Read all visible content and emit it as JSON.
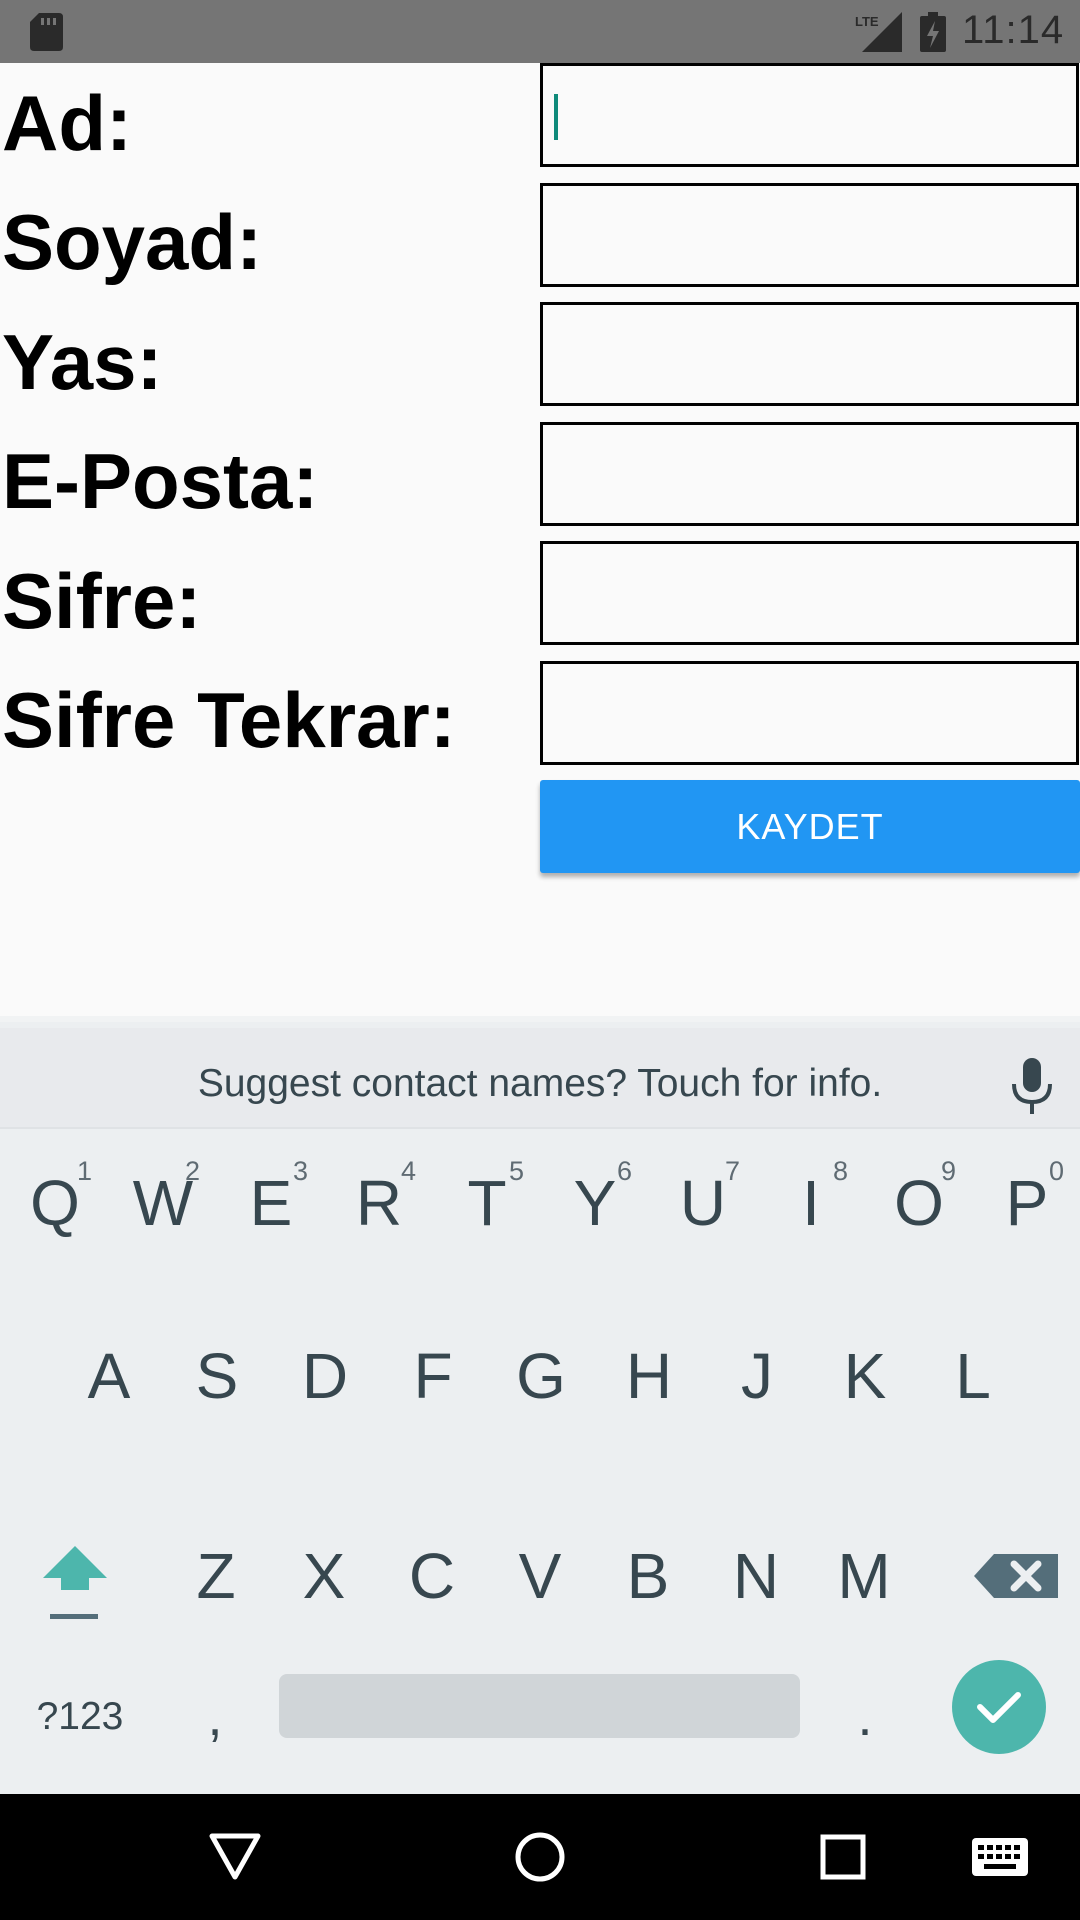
{
  "status_bar": {
    "time": "11:14",
    "network": "LTE",
    "icons": [
      "sd-card-icon",
      "lte-signal-icon",
      "battery-icon"
    ]
  },
  "form": {
    "fields": [
      {
        "label": "Ad:",
        "value": ""
      },
      {
        "label": "Soyad:",
        "value": ""
      },
      {
        "label": "Yas:",
        "value": ""
      },
      {
        "label": "E-Posta:",
        "value": ""
      },
      {
        "label": "Sifre:",
        "value": ""
      },
      {
        "label": "Sifre Tekrar:",
        "value": ""
      }
    ],
    "submit_label": "KAYDET"
  },
  "keyboard": {
    "suggestion": "Suggest contact names? Touch for info.",
    "row1": [
      {
        "key": "Q",
        "hint": "1"
      },
      {
        "key": "W",
        "hint": "2"
      },
      {
        "key": "E",
        "hint": "3"
      },
      {
        "key": "R",
        "hint": "4"
      },
      {
        "key": "T",
        "hint": "5"
      },
      {
        "key": "Y",
        "hint": "6"
      },
      {
        "key": "U",
        "hint": "7"
      },
      {
        "key": "I",
        "hint": "8"
      },
      {
        "key": "O",
        "hint": "9"
      },
      {
        "key": "P",
        "hint": "0"
      }
    ],
    "row2": [
      "A",
      "S",
      "D",
      "F",
      "G",
      "H",
      "J",
      "K",
      "L"
    ],
    "row3": [
      "Z",
      "X",
      "C",
      "V",
      "B",
      "N",
      "M"
    ],
    "symbols_label": "?123",
    "comma": ",",
    "period": ".",
    "accent_color": "#4db6ac"
  },
  "colors": {
    "button": "#2196f3",
    "status_bar": "#757575",
    "nav_bar": "#000000"
  }
}
